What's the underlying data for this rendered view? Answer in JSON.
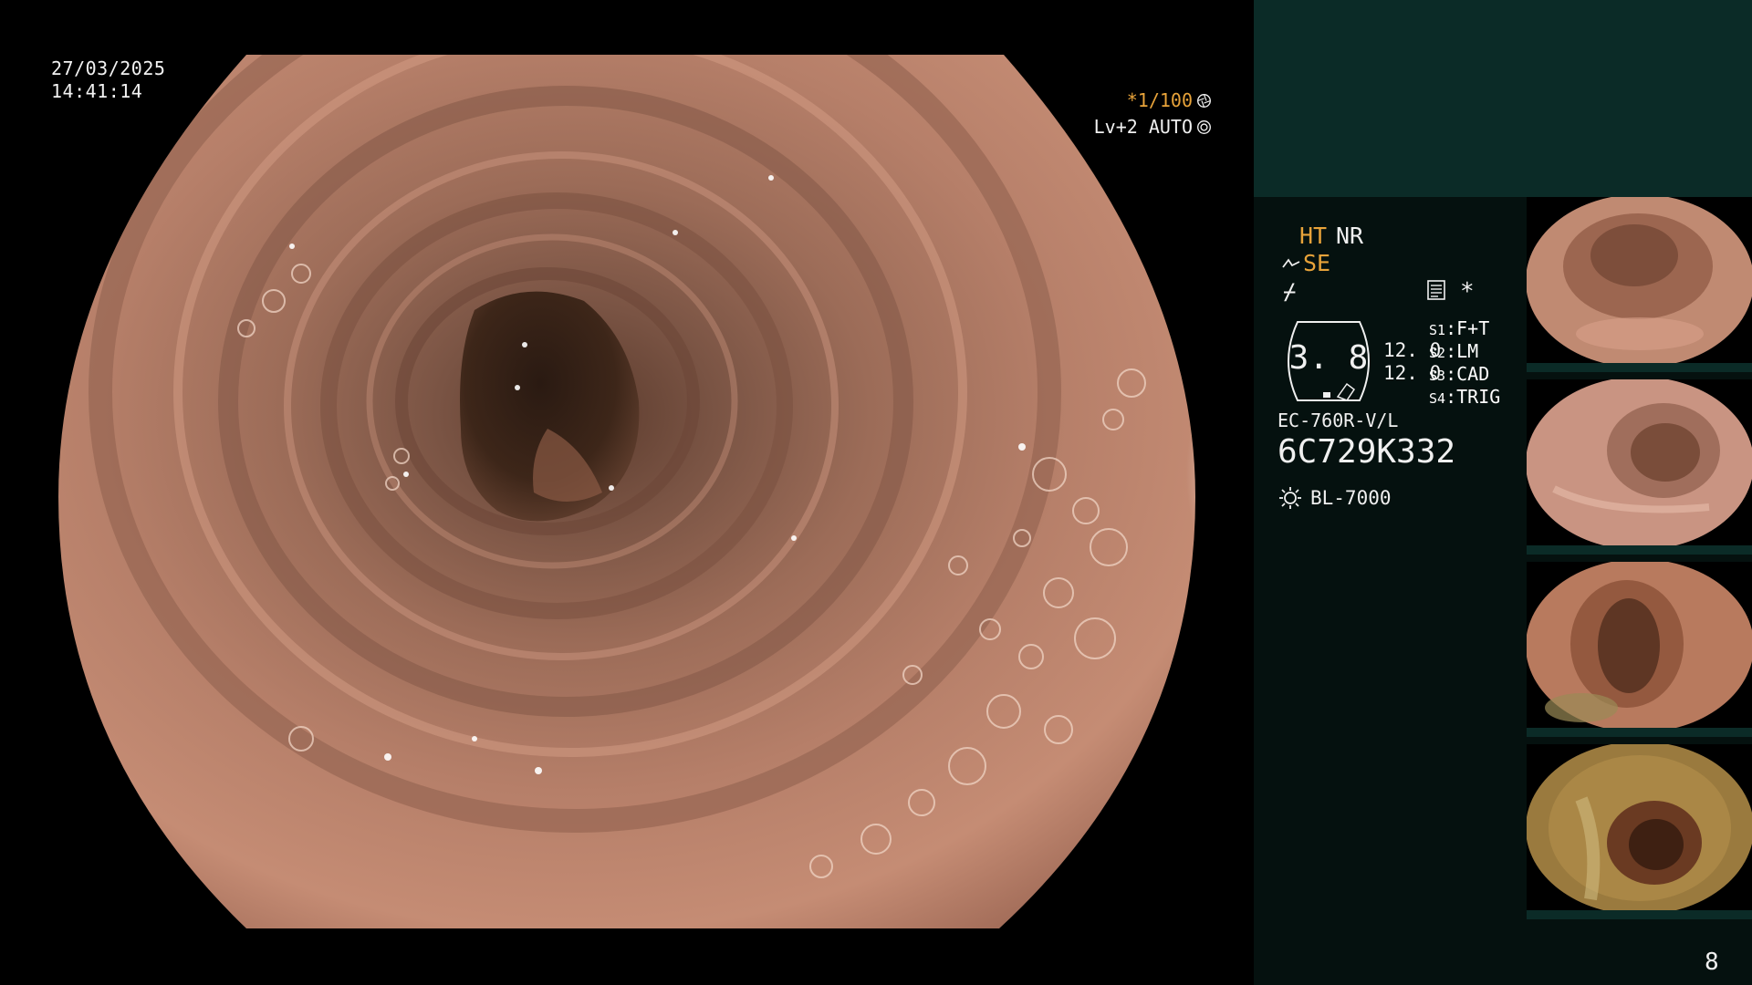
{
  "overlay": {
    "date": "27/03/2025",
    "time": "14:41:14",
    "shutter": "*1/100",
    "mode": "Lv+2 AUTO"
  },
  "panel": {
    "ht": "HT",
    "nr": "NR",
    "se": "SE",
    "enhance_symbol": "⌿",
    "star": "*",
    "scope_value": "3. 8",
    "value1": "12. 0",
    "value2": "12. 0",
    "settings": [
      {
        "key": "S1",
        "value": "F+T"
      },
      {
        "key": "S2",
        "value": "LM"
      },
      {
        "key": "S3",
        "value": "CAD"
      },
      {
        "key": "S4",
        "value": "TRIG"
      }
    ],
    "model": "EC-760R-V/L",
    "serial": "6C729K332",
    "light_source": "BL-7000",
    "page_number": "8"
  },
  "colors": {
    "panel_background": "#05110f",
    "panel_header": "#0b2b27",
    "accent_orange": "#e8a33a",
    "mucosa": "#c08670"
  },
  "icons": {
    "shutter": "aperture-icon",
    "mode": "target-icon",
    "scope": "scope-status-icon",
    "document": "document-icon",
    "light": "light-bulb-icon"
  }
}
